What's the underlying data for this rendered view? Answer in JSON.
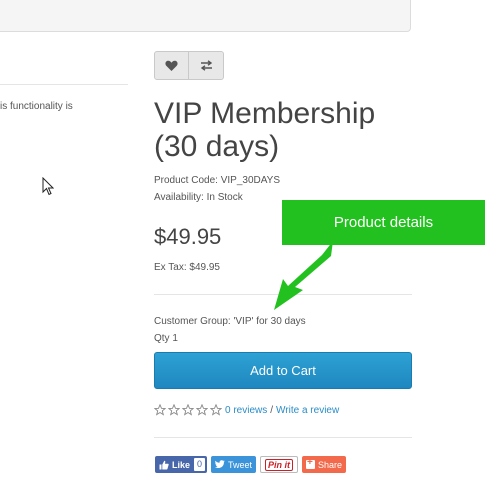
{
  "left_panel": {
    "text": "is functionality is"
  },
  "actions": {
    "wishlist_icon": "heart-icon",
    "compare_icon": "compare-arrows-icon"
  },
  "product": {
    "title": "VIP Membership (30 days)",
    "code": "Product Code: VIP_30DAYS",
    "availability": "Availability: In Stock",
    "price": "$49.95",
    "ex_tax": "Ex Tax: $49.95",
    "customer_group": "Customer Group: 'VIP' for 30 days",
    "qty": "Qty 1"
  },
  "cart": {
    "button_label": "Add to Cart",
    "button_color": "#2496cc"
  },
  "reviews": {
    "stars_filled": 0,
    "stars_total": 5,
    "count_link": "0 reviews",
    "separator": "/",
    "write_link": "Write a review"
  },
  "social": {
    "like_label": "Like",
    "like_count": "0",
    "tweet_label": "Tweet",
    "pin_label": "Pin it",
    "share_label": "Share"
  },
  "annotation": {
    "label": "Product details",
    "color": "#22c11f"
  }
}
